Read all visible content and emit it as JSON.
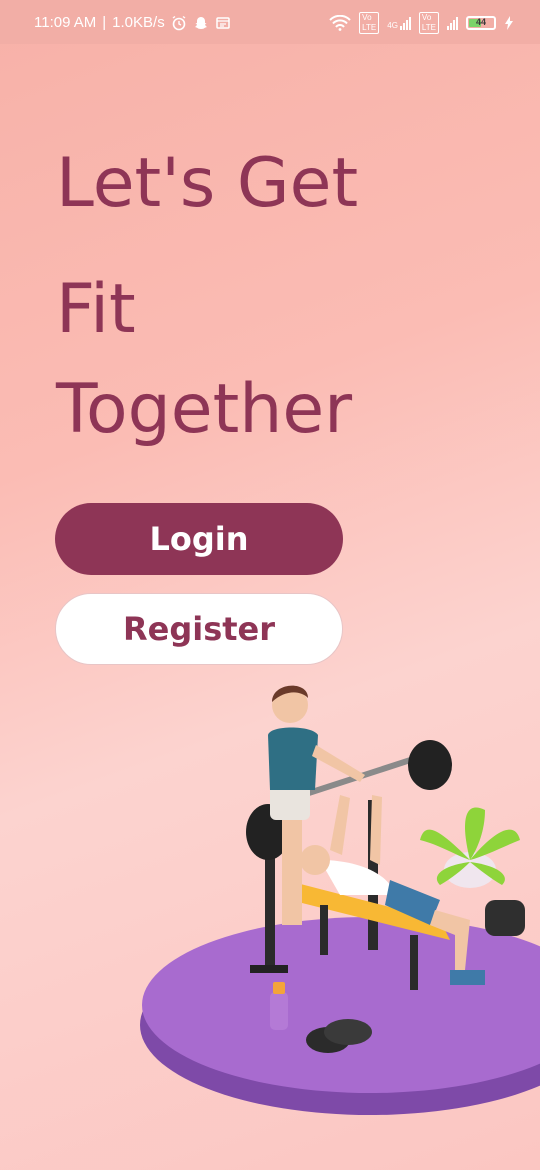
{
  "status_bar": {
    "time": "11:09 AM",
    "network_speed": "1.0KB/s",
    "network_1": "4G",
    "battery_level": "44"
  },
  "headline": {
    "line1": "Let's Get",
    "line2": "Fit",
    "line3": "Together"
  },
  "buttons": {
    "login_label": "Login",
    "register_label": "Register"
  },
  "colors": {
    "brand": "#8e3556",
    "background_top": "#f7b1a8",
    "platform": "#9a63c6"
  }
}
